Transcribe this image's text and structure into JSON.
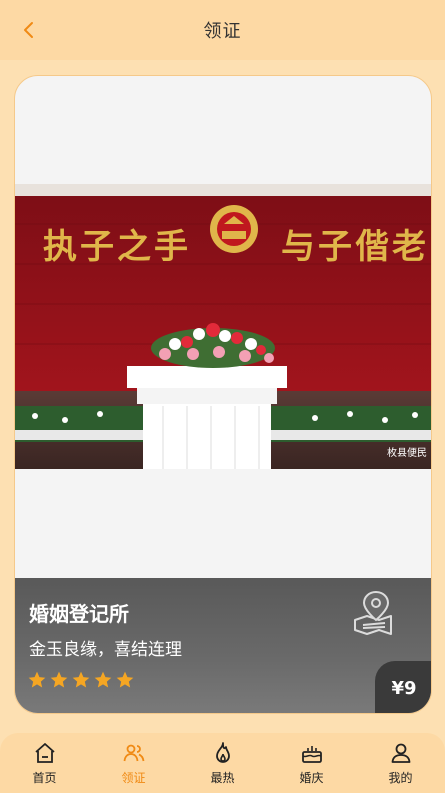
{
  "header": {
    "title": "领证",
    "back_icon": "chevron-left-icon"
  },
  "card": {
    "name": "婚姻登记所",
    "slogan": "金玉良缘，喜结连理",
    "rating": 5,
    "price": "¥9",
    "map_icon": "map-pin-icon",
    "photo": {
      "banner_left": "执子之手",
      "banner_right": "与子偕老",
      "watermark": "枚县便民"
    }
  },
  "tabbar": {
    "items": [
      {
        "label": "首页",
        "icon": "home-icon",
        "active": false
      },
      {
        "label": "领证",
        "icon": "users-icon",
        "active": true
      },
      {
        "label": "最热",
        "icon": "flame-icon",
        "active": false
      },
      {
        "label": "婚庆",
        "icon": "cake-icon",
        "active": false
      },
      {
        "label": "我的",
        "icon": "user-icon",
        "active": false
      }
    ]
  },
  "colors": {
    "accent": "#f08a14",
    "header_bg": "#fdd9a4",
    "page_bg": "#fde0b2",
    "star": "#f5a623"
  }
}
